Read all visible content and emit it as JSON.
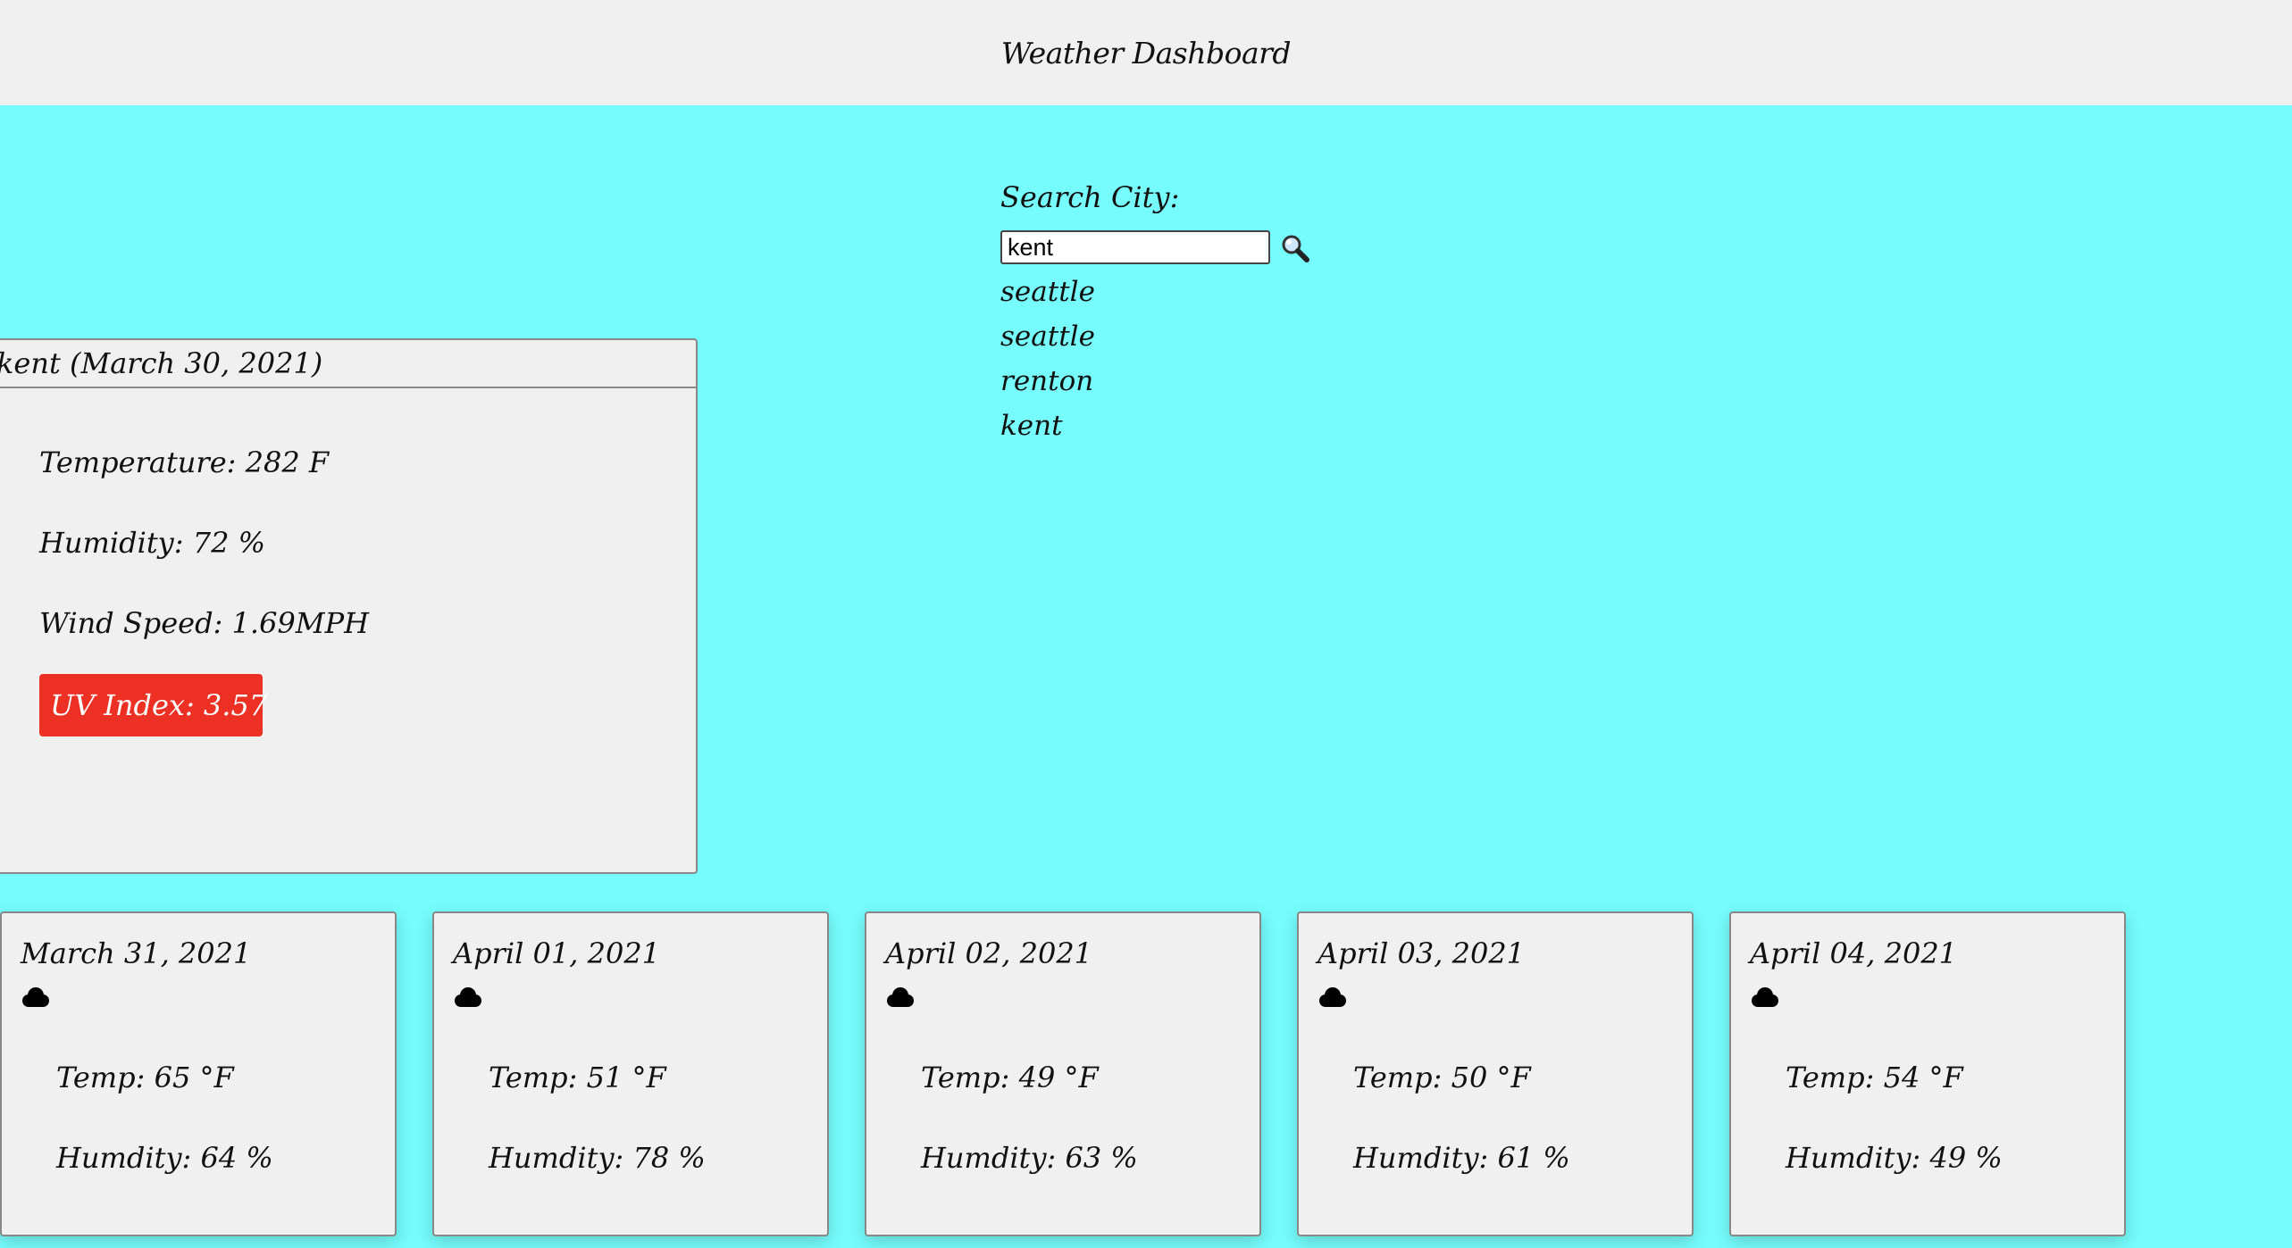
{
  "header": {
    "title": "Weather Dashboard"
  },
  "search": {
    "label": "Search City:",
    "value": "kent",
    "button_icon": "magnifier-icon"
  },
  "history": [
    "seattle",
    "seattle",
    "renton",
    "kent"
  ],
  "current": {
    "title": "kent (March 30, 2021)",
    "temperature": "Temperature: 282 F",
    "humidity": "Humidity: 72 %",
    "wind": "Wind Speed: 1.69MPH",
    "uv": "UV Index: 3.57",
    "uv_color": "#ec3124"
  },
  "forecast": [
    {
      "date": "March 31, 2021",
      "icon": "cloud-icon",
      "temp": "Temp: 65 °F",
      "humidity": "Humdity: 64 %"
    },
    {
      "date": "April 01, 2021",
      "icon": "cloud-icon",
      "temp": "Temp: 51 °F",
      "humidity": "Humdity: 78 %"
    },
    {
      "date": "April 02, 2021",
      "icon": "cloud-icon",
      "temp": "Temp: 49 °F",
      "humidity": "Humdity: 63 %"
    },
    {
      "date": "April 03, 2021",
      "icon": "cloud-icon",
      "temp": "Temp: 50 °F",
      "humidity": "Humdity: 61 %"
    },
    {
      "date": "April 04, 2021",
      "icon": "cloud-icon",
      "temp": "Temp: 54 °F",
      "humidity": "Humdity: 49 %"
    }
  ],
  "colors": {
    "page_background": "#76fcfc",
    "header_background": "#f0f0f0",
    "card_background": "#f0f0f0"
  }
}
